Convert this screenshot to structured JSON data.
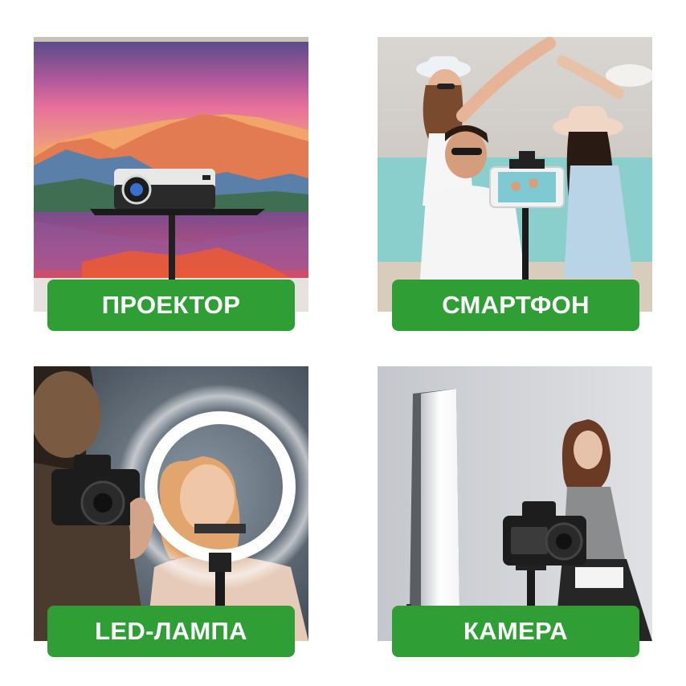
{
  "accent_color": "#2e9e35",
  "tiles": [
    {
      "label": "ПРОЕКТОР",
      "icon": "projector-photo"
    },
    {
      "label": "СМАРТФОН",
      "icon": "smartphone-photo"
    },
    {
      "label": "LED-ЛАМПА",
      "icon": "ring-light-photo"
    },
    {
      "label": "КАМЕРА",
      "icon": "camera-photo"
    }
  ]
}
